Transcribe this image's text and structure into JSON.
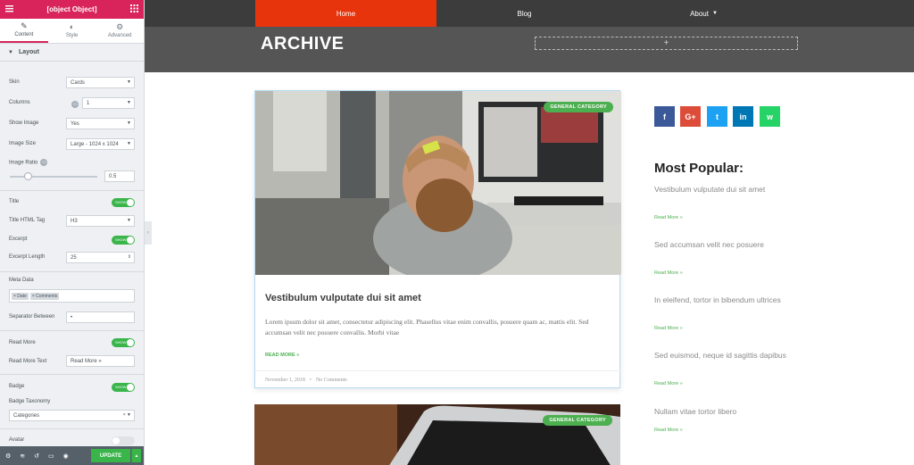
{
  "panel": {
    "title": {
      "label": "Title",
      "state": "SHOW"
    },
    "tabs": [
      "Content",
      "Style",
      "Advanced"
    ],
    "section": "Layout",
    "skin": {
      "label": "Skin",
      "value": "Cards"
    },
    "columns": {
      "label": "Columns",
      "value": "1"
    },
    "show_image": {
      "label": "Show Image",
      "value": "Yes"
    },
    "image_size": {
      "label": "Image Size",
      "value": "Large - 1024 x 1024"
    },
    "image_ratio": {
      "label": "Image Ratio",
      "value": "0.5"
    },
    "title_tag": {
      "label": "Title HTML Tag",
      "value": "H3"
    },
    "excerpt": {
      "label": "Excerpt",
      "state": "SHOW"
    },
    "excerpt_length": {
      "label": "Excerpt Length",
      "value": "25"
    },
    "meta_data": {
      "label": "Meta Data",
      "tags": [
        "× Date",
        "× Comments"
      ]
    },
    "separator": {
      "label": "Separator Between",
      "value": "•"
    },
    "read_more": {
      "label": "Read More",
      "state": "SHOW"
    },
    "read_more_text": {
      "label": "Read More Text",
      "value": "Read More »"
    },
    "badge": {
      "label": "Badge",
      "state": "SHOW"
    },
    "badge_taxonomy": {
      "label": "Badge Taxonomy",
      "value": "Categories"
    },
    "avatar": {
      "label": "Avatar"
    },
    "update": "UPDATE"
  },
  "site": {
    "nav": [
      "Home",
      "Blog",
      "About"
    ],
    "archive_title": "ARCHIVE",
    "add": "+",
    "badge": "GENERAL CATEGORY",
    "post": {
      "title": "Vestibulum vulputate dui sit amet",
      "excerpt": "Lorem ipsum dolor sit amet, consectetur adipiscing elit. Phasellus vitae enim convallis, posuere quam ac, mattis elit. Sed accumsan velit nec posuere convallis. Morbi vitae",
      "read_more": "READ MORE »",
      "date": "November 1, 2018",
      "sep": "•",
      "comments": "No Comments"
    },
    "social": [
      {
        "icon": "f",
        "color": "#3b5998"
      },
      {
        "icon": "G+",
        "color": "#dd4b39"
      },
      {
        "icon": "t",
        "color": "#1da1f2"
      },
      {
        "icon": "in",
        "color": "#0077b5"
      },
      {
        "icon": "w",
        "color": "#25d366"
      }
    ],
    "most_popular": "Most Popular:",
    "popular": [
      {
        "title": "Vestibulum vulputate dui sit amet",
        "link": "Read More »"
      },
      {
        "title": "Sed accumsan velit nec posuere",
        "link": "Read More »"
      },
      {
        "title": "In eleifend, tortor in bibendum ultrices",
        "link": "Read More »"
      },
      {
        "title": "Sed euismod, neque id sagittis dapibus",
        "link": "Read More »"
      },
      {
        "title": "Nullam vitae tortor libero",
        "link": "Read More »"
      }
    ]
  },
  "colors": {
    "brand": "#d8245b",
    "accent": "#4caf50",
    "toggle": "#39b54a",
    "nav_active": "#e8340c"
  }
}
